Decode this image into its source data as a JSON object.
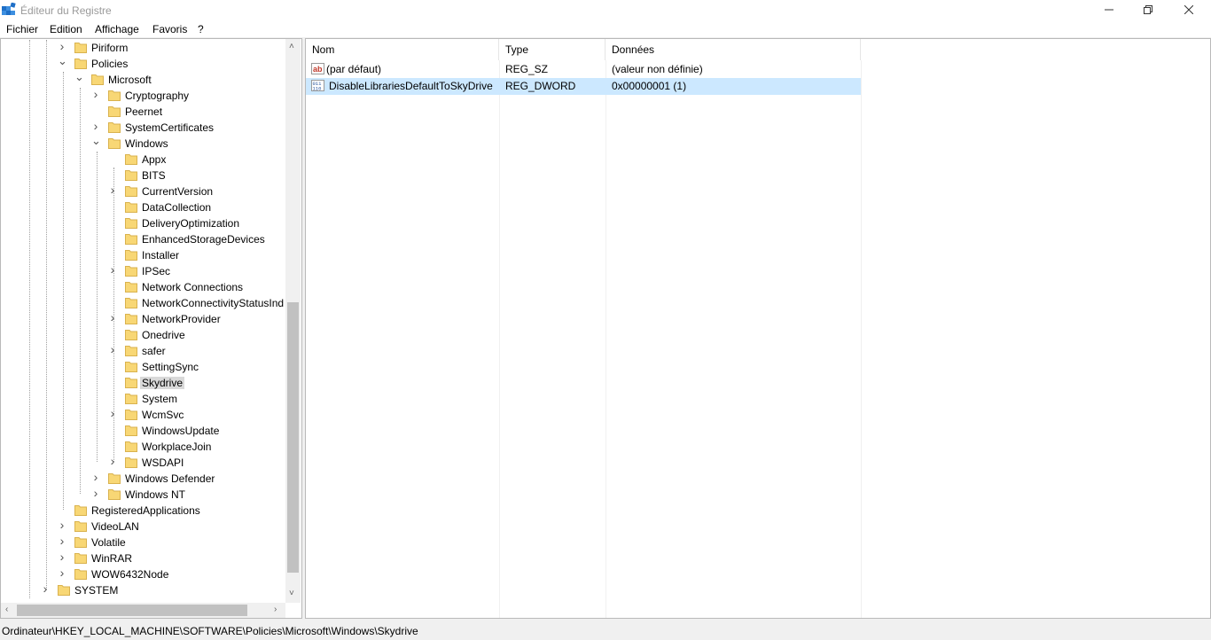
{
  "window": {
    "title": "Éditeur du Registre",
    "icons": {
      "app": "registry-app-icon",
      "minimize": "minimize-icon",
      "maximize": "restore-icon",
      "close": "close-icon"
    }
  },
  "menu": [
    "Fichier",
    "Edition",
    "Affichage",
    "Favoris",
    "?"
  ],
  "tree": [
    {
      "label": "Piriform",
      "expander": "collapsed"
    },
    {
      "label": "Policies",
      "expander": "expanded"
    },
    {
      "label": "Microsoft",
      "expander": "expanded"
    },
    {
      "label": "Cryptography",
      "expander": "collapsed"
    },
    {
      "label": "Peernet",
      "expander": "none"
    },
    {
      "label": "SystemCertificates",
      "expander": "collapsed"
    },
    {
      "label": "Windows",
      "expander": "expanded"
    },
    {
      "label": "Appx",
      "expander": "none"
    },
    {
      "label": "BITS",
      "expander": "none"
    },
    {
      "label": "CurrentVersion",
      "expander": "collapsed"
    },
    {
      "label": "DataCollection",
      "expander": "none"
    },
    {
      "label": "DeliveryOptimization",
      "expander": "none"
    },
    {
      "label": "EnhancedStorageDevices",
      "expander": "none"
    },
    {
      "label": "Installer",
      "expander": "none"
    },
    {
      "label": "IPSec",
      "expander": "collapsed"
    },
    {
      "label": "Network Connections",
      "expander": "none"
    },
    {
      "label": "NetworkConnectivityStatusInd",
      "expander": "none"
    },
    {
      "label": "NetworkProvider",
      "expander": "collapsed"
    },
    {
      "label": "Onedrive",
      "expander": "none"
    },
    {
      "label": "safer",
      "expander": "collapsed"
    },
    {
      "label": "SettingSync",
      "expander": "none"
    },
    {
      "label": "Skydrive",
      "expander": "none",
      "selected": true
    },
    {
      "label": "System",
      "expander": "none"
    },
    {
      "label": "WcmSvc",
      "expander": "collapsed"
    },
    {
      "label": "WindowsUpdate",
      "expander": "none"
    },
    {
      "label": "WorkplaceJoin",
      "expander": "none"
    },
    {
      "label": "WSDAPI",
      "expander": "collapsed"
    },
    {
      "label": "Windows Defender",
      "expander": "collapsed"
    },
    {
      "label": "Windows NT",
      "expander": "collapsed"
    },
    {
      "label": "RegisteredApplications",
      "expander": "none"
    },
    {
      "label": "VideoLAN",
      "expander": "collapsed"
    },
    {
      "label": "Volatile",
      "expander": "collapsed"
    },
    {
      "label": "WinRAR",
      "expander": "collapsed"
    },
    {
      "label": "WOW6432Node",
      "expander": "collapsed"
    },
    {
      "label": "SYSTEM",
      "expander": "collapsed"
    }
  ],
  "columns": {
    "name": "Nom",
    "type": "Type",
    "data": "Données"
  },
  "values": [
    {
      "name": "(par défaut)",
      "type": "REG_SZ",
      "data": "(valeur non définie)",
      "icon": "string-value-icon"
    },
    {
      "name": "DisableLibrariesDefaultToSkyDrive",
      "type": "REG_DWORD",
      "data": "0x00000001 (1)",
      "icon": "binary-value-icon",
      "selected": true
    }
  ],
  "status": {
    "path": "Ordinateur\\HKEY_LOCAL_MACHINE\\SOFTWARE\\Policies\\Microsoft\\Windows\\Skydrive"
  },
  "colors": {
    "selection": "#cce8ff",
    "folder": "#f8d775",
    "tree_selection": "#d9d9d9"
  }
}
